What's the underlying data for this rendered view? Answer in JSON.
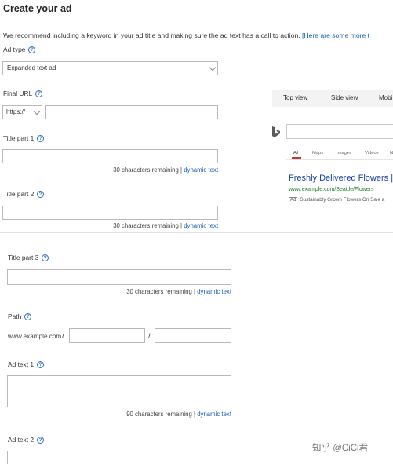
{
  "page": {
    "title": "Create your ad",
    "intro_text": "We recommend including a keyword in your ad title and making sure the ad text has a call to action.",
    "intro_link": "[Here are some more t"
  },
  "form": {
    "ad_type": {
      "label": "Ad type",
      "value": "Expanded text ad"
    },
    "final_url": {
      "label": "Final URL",
      "protocol": "https://",
      "value": ""
    },
    "title_part_1": {
      "label": "Title part 1",
      "remaining": "30 characters remaining",
      "separator": "|",
      "dynamic_link": "dynamic text"
    },
    "title_part_2": {
      "label": "Title part 2",
      "remaining": "30 characters remaining",
      "separator": "|",
      "dynamic_link": "dynamic text"
    },
    "title_part_3": {
      "label": "Title part 3",
      "remaining": "30 characters remaining",
      "separator": "|",
      "dynamic_link": "dynamic text"
    },
    "path": {
      "label": "Path",
      "base_url": "www.example.com",
      "slash1": "/",
      "slash2": "/"
    },
    "ad_text_1": {
      "label": "Ad text 1",
      "remaining": "90 characters remaining",
      "separator": "|",
      "dynamic_link": "dynamic text"
    },
    "ad_text_2": {
      "label": "Ad text 2"
    }
  },
  "preview": {
    "tabs": [
      "Top view",
      "Side view",
      "Mobi"
    ],
    "active_tab": "Top view",
    "search_nav": [
      "All",
      "Maps",
      "Images",
      "Videos",
      "N"
    ],
    "ad": {
      "headline": "Freshly Delivered Flowers |",
      "url": "www.example.com/Seattle/Flowers",
      "badge": "Ad",
      "description": "Sustainably Grown Flowers On Sale a"
    }
  },
  "watermark": "知乎 @CiCi君",
  "colors": {
    "link": "#1a5fb4",
    "ad_headline": "#1a3fa0",
    "ad_url": "#1c7a2b",
    "help_icon": "#2f6fc6"
  }
}
